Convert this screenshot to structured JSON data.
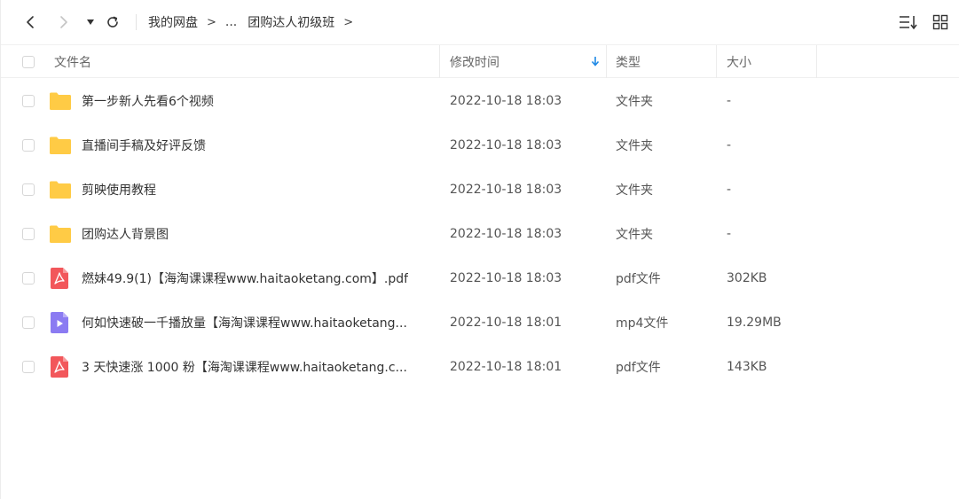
{
  "breadcrumb": {
    "root": "我的网盘",
    "sep": ">",
    "ellipsis": "...",
    "current": "团购达人初级班"
  },
  "columns": {
    "name": "文件名",
    "time": "修改时间",
    "type": "类型",
    "size": "大小"
  },
  "colors": {
    "folder": "#FFCB45",
    "pdf": "#F2575B",
    "video": "#8B7BF2",
    "sort_arrow": "#1E88E5"
  },
  "files": [
    {
      "name": "第一步新人先看6个视频",
      "time": "2022-10-18 18:03",
      "type": "文件夹",
      "size": "-",
      "icon": "folder-icon"
    },
    {
      "name": "直播间手稿及好评反馈",
      "time": "2022-10-18 18:03",
      "type": "文件夹",
      "size": "-",
      "icon": "folder-icon"
    },
    {
      "name": "剪映使用教程",
      "time": "2022-10-18 18:03",
      "type": "文件夹",
      "size": "-",
      "icon": "folder-icon"
    },
    {
      "name": "团购达人背景图",
      "time": "2022-10-18 18:03",
      "type": "文件夹",
      "size": "-",
      "icon": "folder-icon"
    },
    {
      "name": "燃妹49.9(1)【海淘课课程www.haitaoketang.com】.pdf",
      "time": "2022-10-18 18:03",
      "type": "pdf文件",
      "size": "302KB",
      "icon": "pdf-icon"
    },
    {
      "name": "何如快速破一千播放量【海淘课课程www.haitaoketang...",
      "time": "2022-10-18 18:01",
      "type": "mp4文件",
      "size": "19.29MB",
      "icon": "video-file-icon"
    },
    {
      "name": "3 天快速涨 1000 粉【海淘课课程www.haitaoketang.c...",
      "time": "2022-10-18 18:01",
      "type": "pdf文件",
      "size": "143KB",
      "icon": "pdf-icon"
    }
  ]
}
